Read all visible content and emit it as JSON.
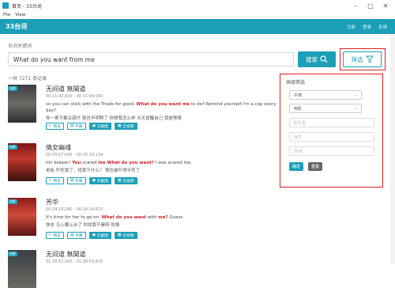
{
  "window": {
    "title": "首页 - 33台词",
    "menu": [
      "File",
      "View"
    ]
  },
  "nav": {
    "brand": "33台词",
    "links": [
      "注册",
      "登录",
      "反馈"
    ]
  },
  "search": {
    "label": "台词关键词",
    "value": "What do you want from me",
    "button": "搜索",
    "filter": "筛选"
  },
  "result_count": "一共 7271 条记录",
  "items": [
    {
      "tag": "电影",
      "title": "无间道 無間道",
      "time": "00:11:42,910 - 00:11:44,000",
      "en_pre": "so you can stick with the Triads for good. ",
      "en_hl": "What do you want me",
      "en_post": " to do? Remind yourself I'm a cop every day?",
      "zh": "你一辈子都古惑仔 我也不明啊了 你想我怎么样 天天提醒自己 我是警察",
      "buttons": [
        "预览",
        "字幕",
        "云截图",
        "云视频"
      ]
    },
    {
      "tag": "电影",
      "title": "倩女幽魂",
      "time": "00:35:07,645 - 00:35:10,134",
      "en_pre": "Inn keeper! ",
      "en_hl": "You",
      "en_mid": " scared ",
      "en_hl2": "me",
      "en_mid2": " ",
      "en_hl3": "What do you want?",
      "en_post": " I was scared too",
      "zh": "老板  吓死我了，找我干什么？ 我也被吓得半死了",
      "buttons": [
        "预览",
        "字幕",
        "云截图",
        "云视频"
      ]
    },
    {
      "tag": "电影",
      "title": "芳华",
      "time": "00:24:23,280 - 00:24:24,670",
      "en_pre": "It's time for her to go on. ",
      "en_hl": "What do you want",
      "en_mid": " with ",
      "en_hl2": "me?",
      "en_post": " Guess",
      "zh": "快去 马上要上台了  你找我干嘛呀  你猜",
      "buttons": [
        "预览",
        "字幕",
        "云截图",
        "云视频"
      ]
    },
    {
      "tag": "电影",
      "title": "无间道 無間道",
      "time": "01:28:51,500 - 01:28:53,630"
    }
  ],
  "filter_panel": {
    "title": "高级筛选",
    "select1": "中通",
    "select2": "电影",
    "inputs": [
      "影片名",
      "演员",
      "导演"
    ],
    "confirm": "确定",
    "reset": "重置"
  },
  "colors": {
    "accent": "#1c9fb7",
    "highlight": "#d0202a",
    "annotation": "#e02020"
  }
}
